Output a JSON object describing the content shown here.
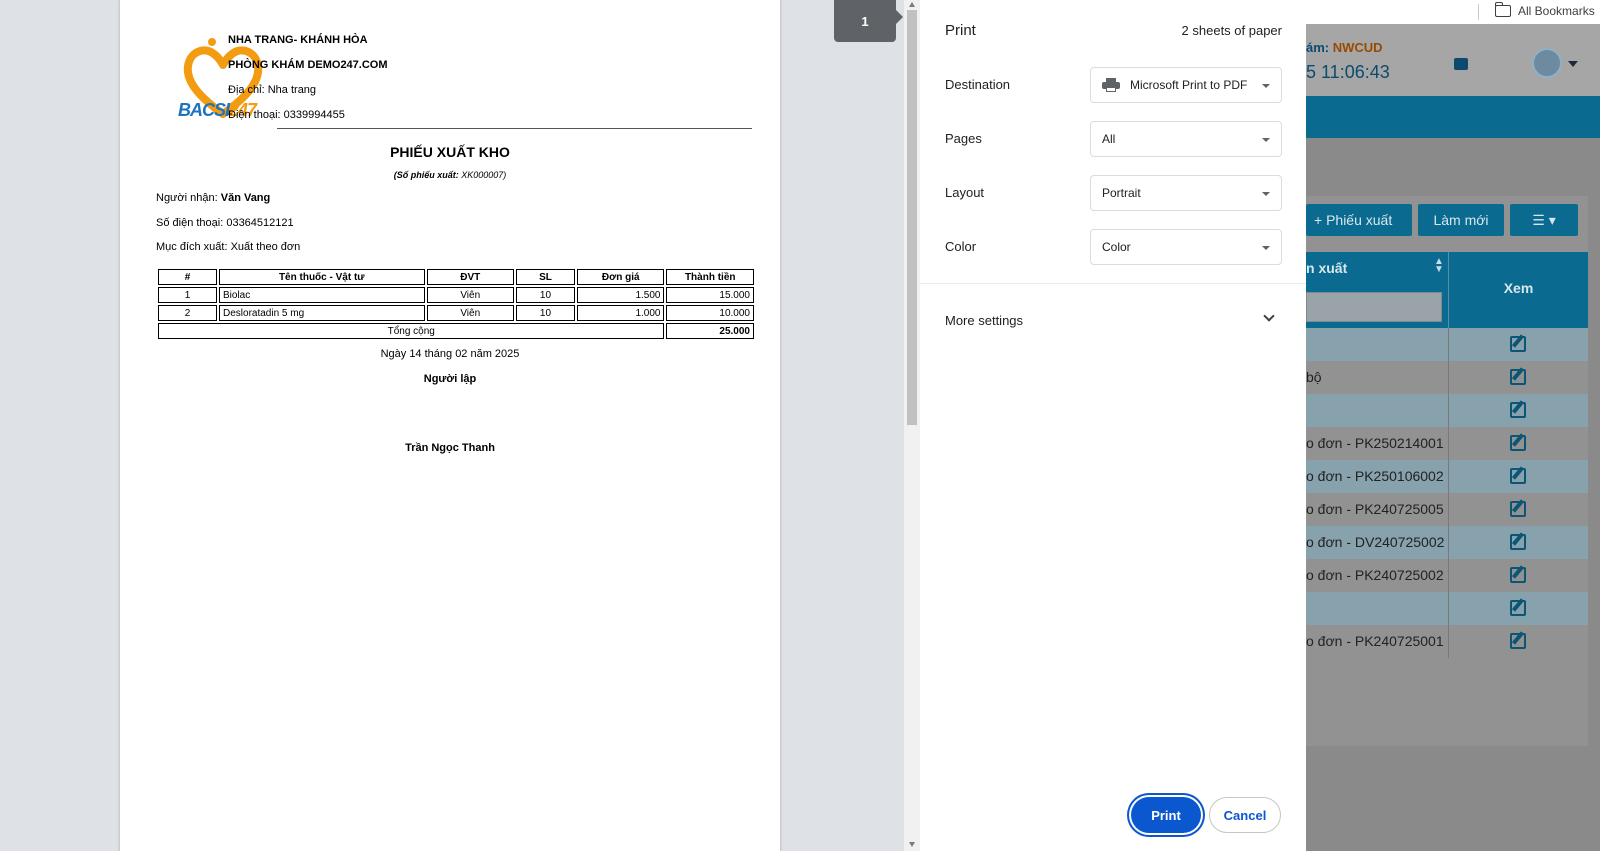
{
  "preview": {
    "page_number": "1",
    "clinic": {
      "region": "NHA TRANG- KHÁNH HÒA",
      "name": "PHÒNG KHÁM DEMO247.COM",
      "address": "Địa chỉ: Nha trang",
      "phone": "Điện thoại: 0339994455",
      "logo_text_a": "BACSI",
      "logo_text_b": "247"
    },
    "title": "PHIẾU XUẤT KHO",
    "receipt_label": "(Số phiếu xuất:",
    "receipt_no": " XK000007)",
    "recipient_label": "Người nhận: ",
    "recipient": "Văn Vang",
    "phone_line": "Số điện thoại: 03364512121",
    "purpose_line": "Mục đích xuất: Xuất theo đơn",
    "table": {
      "headers": [
        "#",
        "Tên thuốc - Vật tư",
        "ĐVT",
        "SL",
        "Đơn giá",
        "Thành tiền"
      ],
      "rows": [
        [
          "1",
          "Biolac",
          "Viên",
          "10",
          "1.500",
          "15.000"
        ],
        [
          "2",
          "Desloratadin 5 mg",
          "Viên",
          "10",
          "1.000",
          "10.000"
        ]
      ],
      "total_label": "Tổng cộng",
      "total_value": "25.000"
    },
    "date_line": "Ngày 14 tháng 02 năm 2025",
    "signer_role": "Người lập",
    "signer_name": "Trần Ngọc Thanh"
  },
  "dialog": {
    "title": "Print",
    "sheets": "2 sheets of paper",
    "destination_label": "Destination",
    "destination_value": "Microsoft Print to PDF",
    "pages_label": "Pages",
    "pages_value": "All",
    "layout_label": "Layout",
    "layout_value": "Portrait",
    "color_label": "Color",
    "color_value": "Color",
    "more_settings": "More settings",
    "print_button": "Print",
    "cancel_button": "Cancel"
  },
  "background": {
    "bookmarks": "All Bookmarks",
    "header_label": "ám: ",
    "header_code": "NWCUD",
    "header_time": "5 11:06:43",
    "btn_export": "+  Phiếu xuất",
    "btn_refresh": "Làm mới",
    "col_left": "n xuất",
    "col_right": "Xem",
    "rows": [
      "",
      "bộ",
      "",
      "o đơn - PK250214001",
      "o đơn - PK250106002",
      "o đơn - PK240725005",
      "o đơn - DV240725002",
      "o đơn - PK240725002",
      "",
      "o đơn - PK240725001"
    ]
  },
  "colors": {
    "accent": "#0b57d0",
    "app_blue": "#0b6a8f",
    "logo_orange": "#f39c12",
    "logo_blue": "#1e73be"
  }
}
